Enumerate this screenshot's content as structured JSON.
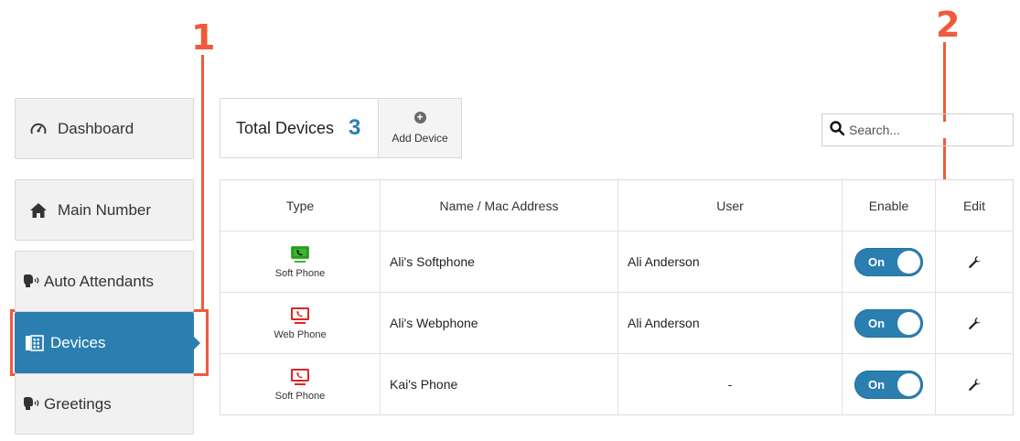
{
  "annotations": [
    "1",
    "2"
  ],
  "sidebar": {
    "items": [
      {
        "label": "Dashboard",
        "icon": "dashboard-gauge-icon"
      },
      {
        "label": "Main Number",
        "icon": "home-icon"
      },
      {
        "label": "Auto Attendants",
        "icon": "speaking-head-icon"
      },
      {
        "label": "Devices",
        "icon": "phone-device-icon",
        "active": true
      },
      {
        "label": "Greetings",
        "icon": "speaking-head-icon"
      }
    ]
  },
  "summary": {
    "total_label": "Total Devices",
    "total_count": "3",
    "add_label": "Add Device"
  },
  "search": {
    "placeholder": "Search..."
  },
  "table": {
    "headers": [
      "Type",
      "Name / Mac Address",
      "User",
      "Enable",
      "Edit"
    ],
    "rows": [
      {
        "type": "Soft Phone",
        "icon_color": "#3cb531",
        "name": "Ali's Softphone",
        "user": "Ali Anderson",
        "enable": "On"
      },
      {
        "type": "Web Phone",
        "icon_color": "#e02424",
        "name": "Ali's Webphone",
        "user": "Ali Anderson",
        "enable": "On"
      },
      {
        "type": "Soft Phone",
        "icon_color": "#e02424",
        "name": "Kai's Phone",
        "user": "-",
        "enable": "On"
      }
    ]
  },
  "colors": {
    "accent": "#2b7fb0",
    "annotation": "#f05a3c"
  }
}
